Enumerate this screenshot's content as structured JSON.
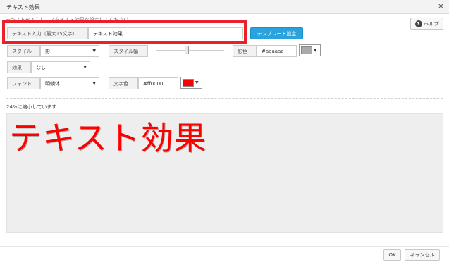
{
  "window": {
    "title": "テキスト効果",
    "close_symbol": "×"
  },
  "instruction": "テキストを入力し、スタイル・効果を設定してください",
  "help": {
    "icon": "help-circle-icon",
    "icon_glyph": "?",
    "label": "ヘルプ"
  },
  "text_input": {
    "label": "テキスト入力（最大15文字）",
    "value": "テキスト効果"
  },
  "template_button": "テンプレート設定",
  "style": {
    "label": "スタイル",
    "value": "影"
  },
  "style_width": {
    "label": "スタイル幅",
    "level_percent": 45
  },
  "shadow_color": {
    "label": "影色",
    "value": "#aaaaaa",
    "swatch": "#aaaaaa"
  },
  "effect": {
    "label": "効果",
    "value": "なし"
  },
  "font": {
    "label": "フォント",
    "value": "明朝体"
  },
  "text_color": {
    "label": "文字色",
    "value": "#ff0000",
    "swatch": "#ff0000"
  },
  "scale_note": "24%に縮小しています",
  "preview_text": "テキスト効果",
  "colors": {
    "highlight": "#e8212a",
    "accent": "#2aa3dc",
    "preview_bg": "#eeeeee"
  },
  "footer": {
    "ok": "OK",
    "cancel": "キャンセル"
  }
}
